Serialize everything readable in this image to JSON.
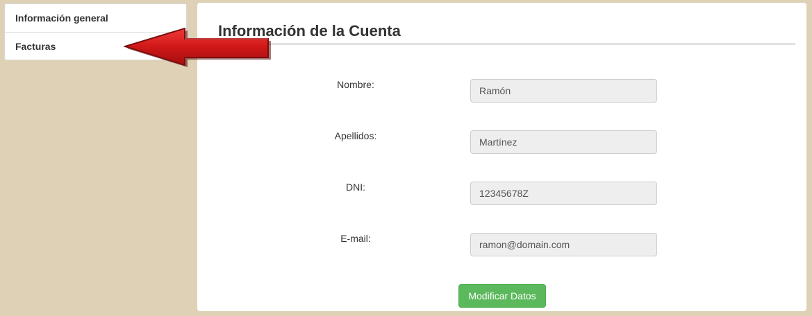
{
  "sidebar": {
    "items": [
      {
        "label": "Información general"
      },
      {
        "label": "Facturas"
      }
    ]
  },
  "main": {
    "title": "Información de la Cuenta",
    "form": {
      "fields": [
        {
          "label": "Nombre:",
          "value": "Ramón"
        },
        {
          "label": "Apellidos:",
          "value": "Martínez"
        },
        {
          "label": "DNI:",
          "value": "12345678Z"
        },
        {
          "label": "E-mail:",
          "value": "ramon@domain.com"
        }
      ],
      "submit_label": "Modificar Datos"
    }
  },
  "annotation": {
    "arrow_icon": "red-arrow-left-icon",
    "arrow_color": "#d01818"
  },
  "colors": {
    "background": "#ded1b6",
    "panel": "#ffffff",
    "input_bg": "#eeeeee",
    "button": "#5cb85c",
    "text": "#333333"
  }
}
